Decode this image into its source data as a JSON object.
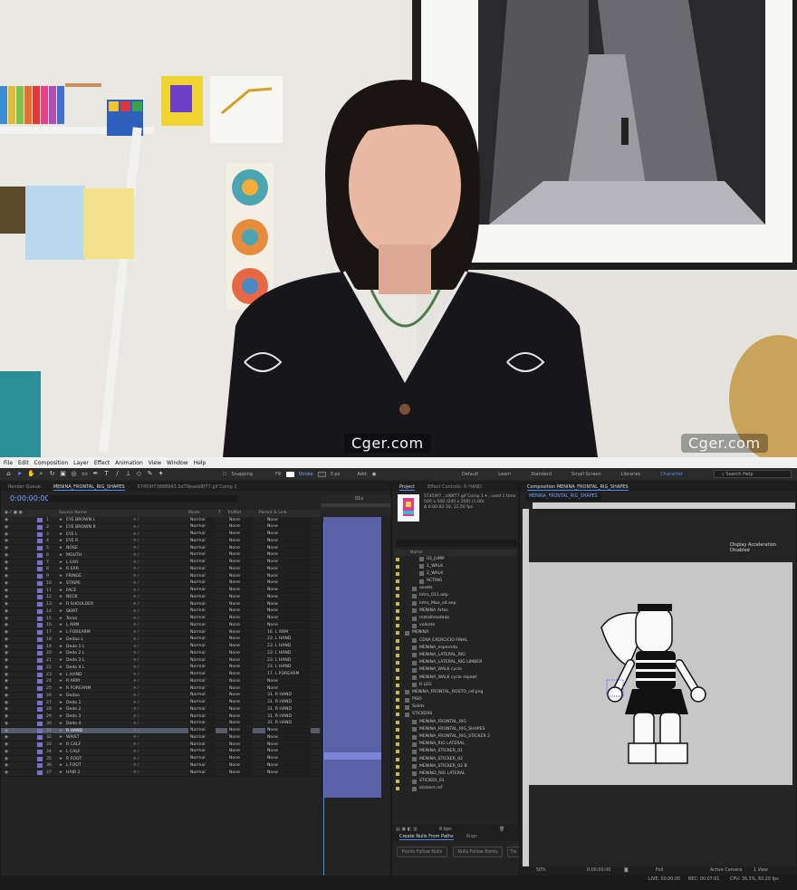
{
  "watermark": "Cger.com",
  "menu": [
    "File",
    "Edit",
    "Composition",
    "Layer",
    "Effect",
    "Animation",
    "View",
    "Window",
    "Help"
  ],
  "toolbar": {
    "snapping": "Snapping",
    "fill": "Fill",
    "stroke": "Stroke",
    "stroke_px": "3 px",
    "add": "Add:"
  },
  "workspaces": [
    "Default",
    "Learn",
    "Standard",
    "Small Screen",
    "Libraries",
    "Character"
  ],
  "active_workspace": "Character",
  "search_help": "Search Help",
  "timeline": {
    "tabs": [
      "Render Queue",
      "MENINA_FRONTAL_RIG_SHAPES",
      "57459f73888943.5d79eaeb8f77.gif Comp 1"
    ],
    "timecode": "0:00:00:00",
    "columns": {
      "source_name": "Source Name",
      "mode": "Mode",
      "t": "T",
      "trkmat": "TrkMat",
      "parent": "Parent & Link"
    },
    "ruler_label": "01s",
    "layers": [
      {
        "num": "1",
        "name": "EYE BROWN L",
        "mode": "Normal",
        "trk": "None",
        "parent": "None"
      },
      {
        "num": "2",
        "name": "EYE BROWN R",
        "mode": "Normal",
        "trk": "None",
        "parent": "None"
      },
      {
        "num": "3",
        "name": "EYE L",
        "mode": "Normal",
        "trk": "None",
        "parent": "None"
      },
      {
        "num": "4",
        "name": "EYE R",
        "mode": "Normal",
        "trk": "None",
        "parent": "None"
      },
      {
        "num": "5",
        "name": "NOSE",
        "mode": "Normal",
        "trk": "None",
        "parent": "None"
      },
      {
        "num": "6",
        "name": "MOUTH",
        "mode": "Normal",
        "trk": "None",
        "parent": "None"
      },
      {
        "num": "7",
        "name": "L EAR",
        "mode": "Normal",
        "trk": "None",
        "parent": "None"
      },
      {
        "num": "8",
        "name": "R EAR",
        "mode": "Normal",
        "trk": "None",
        "parent": "None"
      },
      {
        "num": "9",
        "name": "FRINGE",
        "mode": "Normal",
        "trk": "None",
        "parent": "None"
      },
      {
        "num": "10",
        "name": "STRIPE",
        "mode": "Normal",
        "trk": "None",
        "parent": "None"
      },
      {
        "num": "11",
        "name": "FACE",
        "mode": "Normal",
        "trk": "None",
        "parent": "None"
      },
      {
        "num": "12",
        "name": "NECK",
        "mode": "Normal",
        "trk": "None",
        "parent": "None"
      },
      {
        "num": "13",
        "name": "R SHOULDER",
        "mode": "Normal",
        "trk": "None",
        "parent": "None"
      },
      {
        "num": "14",
        "name": "SKIRT",
        "mode": "Normal",
        "trk": "None",
        "parent": "None"
      },
      {
        "num": "15",
        "name": "Torax",
        "mode": "Normal",
        "trk": "None",
        "parent": "None"
      },
      {
        "num": "16",
        "name": "L ARM",
        "mode": "Normal",
        "trk": "None",
        "parent": "None"
      },
      {
        "num": "17",
        "name": "L FOREARM",
        "mode": "Normal",
        "trk": "None",
        "parent": "16. L ARM"
      },
      {
        "num": "18",
        "name": "Dedao L",
        "mode": "Normal",
        "trk": "None",
        "parent": "23. L HAND"
      },
      {
        "num": "19",
        "name": "Dedo 1 L",
        "mode": "Normal",
        "trk": "None",
        "parent": "23. L HAND"
      },
      {
        "num": "20",
        "name": "Dedo 2 L",
        "mode": "Normal",
        "trk": "None",
        "parent": "23. L HAND"
      },
      {
        "num": "21",
        "name": "Dedo 3 L",
        "mode": "Normal",
        "trk": "None",
        "parent": "23. L HAND"
      },
      {
        "num": "22",
        "name": "Dedo 4 L",
        "mode": "Normal",
        "trk": "None",
        "parent": "23. L HAND"
      },
      {
        "num": "23",
        "name": "L HAND",
        "mode": "Normal",
        "trk": "None",
        "parent": "17. L FOREARM"
      },
      {
        "num": "24",
        "name": "R ARM",
        "mode": "Normal",
        "trk": "None",
        "parent": "None"
      },
      {
        "num": "25",
        "name": "R FOREARM",
        "mode": "Normal",
        "trk": "None",
        "parent": "None"
      },
      {
        "num": "26",
        "name": "Dedao",
        "mode": "Normal",
        "trk": "None",
        "parent": "31. R HAND"
      },
      {
        "num": "27",
        "name": "Dedo 1",
        "mode": "Normal",
        "trk": "None",
        "parent": "31. R HAND"
      },
      {
        "num": "28",
        "name": "Dedo 2",
        "mode": "Normal",
        "trk": "None",
        "parent": "31. R HAND"
      },
      {
        "num": "29",
        "name": "Dedo 3",
        "mode": "Normal",
        "trk": "None",
        "parent": "31. R HAND"
      },
      {
        "num": "30",
        "name": "Dedo 4",
        "mode": "Normal",
        "trk": "None",
        "parent": "31. R HAND"
      },
      {
        "num": "31",
        "name": "R HAND",
        "mode": "Normal",
        "trk": "None",
        "parent": "None",
        "selected": true
      },
      {
        "num": "32",
        "name": "WAIST",
        "mode": "Normal",
        "trk": "None",
        "parent": "None"
      },
      {
        "num": "33",
        "name": "R CALF",
        "mode": "Normal",
        "trk": "None",
        "parent": "None"
      },
      {
        "num": "34",
        "name": "L CALF",
        "mode": "Normal",
        "trk": "None",
        "parent": "None"
      },
      {
        "num": "35",
        "name": "R FOOT",
        "mode": "Normal",
        "trk": "None",
        "parent": "None"
      },
      {
        "num": "36",
        "name": "L FOOT",
        "mode": "Normal",
        "trk": "None",
        "parent": "None"
      },
      {
        "num": "37",
        "name": "HAIR 2",
        "mode": "Normal",
        "trk": "None",
        "parent": "None"
      }
    ]
  },
  "project": {
    "tabs": [
      "Project",
      "Effect Controls: R HAND"
    ],
    "info": [
      "57459f7...c88f77.gif Comp 1 ▾ , used 1 time",
      "500 x 500 (200 x 250) (1,00)",
      "Δ 0:00:02:10, 12,50 fps"
    ],
    "name_header": "Name",
    "items": [
      {
        "name": "03_JUMP",
        "indent": 2
      },
      {
        "name": "1_WALK",
        "indent": 2
      },
      {
        "name": "2_WALK",
        "indent": 2
      },
      {
        "name": "ACTING",
        "indent": 2
      },
      {
        "name": "assets",
        "indent": 1
      },
      {
        "name": "Intro_011.aep",
        "indent": 1
      },
      {
        "name": "Intro_Mao_v4.aep",
        "indent": 1
      },
      {
        "name": "MENINA Artes",
        "indent": 1
      },
      {
        "name": "metalheadaep",
        "indent": 1
      },
      {
        "name": "volante",
        "indent": 1
      },
      {
        "name": "MENINA",
        "indent": 0
      },
      {
        "name": "CENA EXERCICIO FINAL",
        "indent": 1
      },
      {
        "name": "MENINA_espernda",
        "indent": 1
      },
      {
        "name": "MENINA_LATERAL_RIG",
        "indent": 1
      },
      {
        "name": "MENINA_LATERAL_RIG LIMBER",
        "indent": 1
      },
      {
        "name": "MENINA_WALK cycle",
        "indent": 1
      },
      {
        "name": "MENINA_WALK cycle repeat",
        "indent": 1
      },
      {
        "name": "R LEG",
        "indent": 1
      },
      {
        "name": "MENINA_FRONTAL_ROSTO_ref.png",
        "indent": 0
      },
      {
        "name": "PISO",
        "indent": 0
      },
      {
        "name": "Solids",
        "indent": 0
      },
      {
        "name": "STICKERS",
        "indent": 0
      },
      {
        "name": "MENINA_FRONTAL_RIG",
        "indent": 1
      },
      {
        "name": "MENINA_FRONTAL_RIG_SHAPES",
        "indent": 1
      },
      {
        "name": "MENINA_FRONTAL_RIG_STICKER 2",
        "indent": 1
      },
      {
        "name": "MENINA_RIG LATERAL",
        "indent": 1
      },
      {
        "name": "MENINA_STICKER_01",
        "indent": 1
      },
      {
        "name": "MENINA_STICKER_02",
        "indent": 1
      },
      {
        "name": "MENINA_STICKER_02 B",
        "indent": 1
      },
      {
        "name": "MENINO_RIG LATERAL",
        "indent": 1
      },
      {
        "name": "STICKER_01",
        "indent": 1
      },
      {
        "name": "stickers ref",
        "indent": 1
      }
    ],
    "bpc": "8 bpc",
    "cnfp_tabs": [
      "Create Nulls From Paths",
      "Align"
    ],
    "buttons": [
      "Points Follow Nulls",
      "Nulls Follow Points",
      "Tra"
    ]
  },
  "composition": {
    "tab": "Composition MENINA_FRONTAL_RIG_SHAPES",
    "label": "MENINA_FRONTAL_RIG_SHAPES",
    "display_accel": "Display Acceleration Disabled",
    "zoom": "50%",
    "timecode": "0:00:00:00",
    "resolution": "Full",
    "camera": "Active Camera",
    "views": "1 View"
  },
  "status": {
    "live": "LIVE: 00:00:00",
    "rec": "REC: 00:07:01",
    "cpu": "CPU: 36.3%, 60.20 fps"
  },
  "colors": {
    "accent": "#4b8df8",
    "label_purple": "#7a6fd1",
    "layer_bar": "#5a5fa6",
    "folder_yellow": "#c8b93a"
  }
}
